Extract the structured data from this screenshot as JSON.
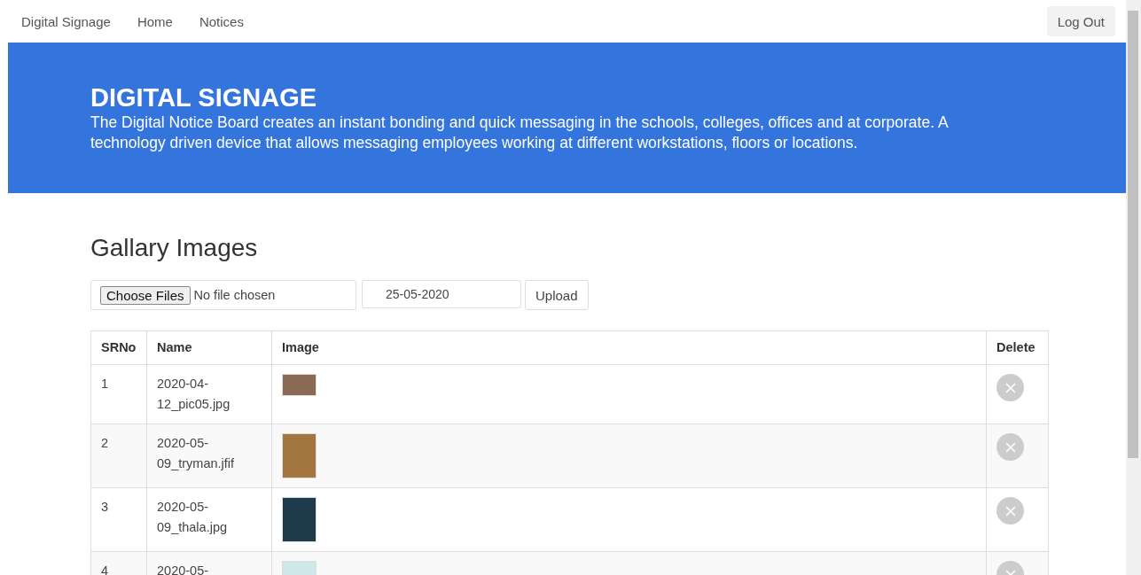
{
  "navbar": {
    "brand": "Digital Signage",
    "links": [
      {
        "label": "Home"
      },
      {
        "label": "Notices"
      }
    ],
    "logout": "Log Out"
  },
  "banner": {
    "title": "DIGITAL SIGNAGE",
    "text": "The Digital Notice Board creates an instant bonding and quick messaging in the schools, colleges, offices and at corporate. A technology driven device that allows messaging employees working at different workstations, floors or locations."
  },
  "gallery": {
    "heading": "Gallary Images",
    "file_button": "Choose Files",
    "file_status": "No file chosen",
    "date": "25-05-2020",
    "upload": "Upload"
  },
  "table": {
    "columns": [
      "SRNo",
      "Name",
      "Image",
      "Delete"
    ],
    "rows": [
      {
        "srno": "1",
        "name": "2020-04-12_pic05.jpg",
        "kind": "wide"
      },
      {
        "srno": "2",
        "name": "2020-05-09_tryman.jfif",
        "kind": "tall"
      },
      {
        "srno": "3",
        "name": "2020-05-09_thala.jpg",
        "kind": "tall"
      },
      {
        "srno": "4",
        "name": "2020-05-",
        "kind": "wide"
      }
    ]
  }
}
